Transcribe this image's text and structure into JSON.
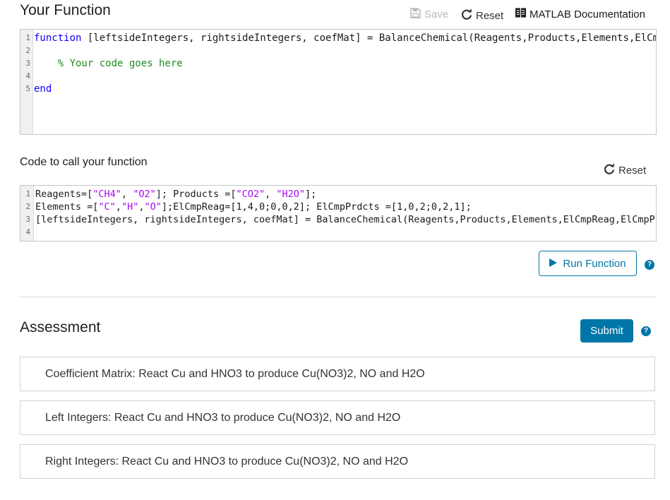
{
  "function_section": {
    "title": "Your Function",
    "save_label": "Save",
    "reset_label": "Reset",
    "docs_label": "MATLAB Documentation",
    "lines": [
      {
        "n": "1",
        "parts": [
          {
            "t": "function",
            "c": "kw"
          },
          {
            "t": " [leftsideIntegers, rightsideIntegers, coefMat] = BalanceChemical(Reagents,Products,Elements,ElCmpReag,ElCmpPrdcts)",
            "c": ""
          }
        ]
      },
      {
        "n": "2",
        "parts": []
      },
      {
        "n": "3",
        "parts": [
          {
            "t": "    ",
            "c": ""
          },
          {
            "t": "% Your code goes here",
            "c": "cm"
          }
        ]
      },
      {
        "n": "4",
        "parts": []
      },
      {
        "n": "5",
        "parts": [
          {
            "t": "end",
            "c": "kw"
          }
        ]
      }
    ]
  },
  "call_section": {
    "title": "Code to call your function",
    "reset_label": "Reset",
    "lines": [
      {
        "n": "1",
        "parts": [
          {
            "t": "Reagents=[",
            "c": ""
          },
          {
            "t": "\"CH4\"",
            "c": "str"
          },
          {
            "t": ", ",
            "c": ""
          },
          {
            "t": "\"O2\"",
            "c": "str"
          },
          {
            "t": "]; Products =[",
            "c": ""
          },
          {
            "t": "\"CO2\"",
            "c": "str"
          },
          {
            "t": ", ",
            "c": ""
          },
          {
            "t": "\"H2O\"",
            "c": "str"
          },
          {
            "t": "];",
            "c": ""
          }
        ]
      },
      {
        "n": "2",
        "parts": [
          {
            "t": "Elements =[",
            "c": ""
          },
          {
            "t": "\"C\"",
            "c": "str"
          },
          {
            "t": ",",
            "c": ""
          },
          {
            "t": "\"H\"",
            "c": "str"
          },
          {
            "t": ",",
            "c": ""
          },
          {
            "t": "\"O\"",
            "c": "str"
          },
          {
            "t": "];ElCmpReag=[1,4,0;0,0,2]; ElCmpPrdcts =[1,0,2;0,2,1];",
            "c": ""
          }
        ]
      },
      {
        "n": "3",
        "parts": [
          {
            "t": "[leftsideIntegers, rightsideIntegers, coefMat] = BalanceChemical(Reagents,Products,Elements,ElCmpReag,ElCmpPrdcts)",
            "c": ""
          }
        ]
      },
      {
        "n": "4",
        "parts": []
      }
    ],
    "run_label": "Run Function",
    "help_symbol": "?"
  },
  "assessment": {
    "title": "Assessment",
    "submit_label": "Submit",
    "help_symbol": "?",
    "tests": [
      "Coefficient Matrix: React Cu and HNO3 to produce Cu(NO3)2, NO and H2O",
      "Left Integers: React Cu and HNO3 to produce Cu(NO3)2, NO and H2O",
      "Right Integers: React Cu and HNO3 to produce Cu(NO3)2, NO and H2O"
    ]
  },
  "icons": {
    "save": "save-icon",
    "reset": "reset-icon",
    "docs": "book-icon",
    "run": "play-icon",
    "help": "help-icon"
  },
  "colors": {
    "accent": "#0076a8",
    "keyword": "#0e00ff",
    "comment": "#228b22",
    "string": "#a709f5"
  }
}
